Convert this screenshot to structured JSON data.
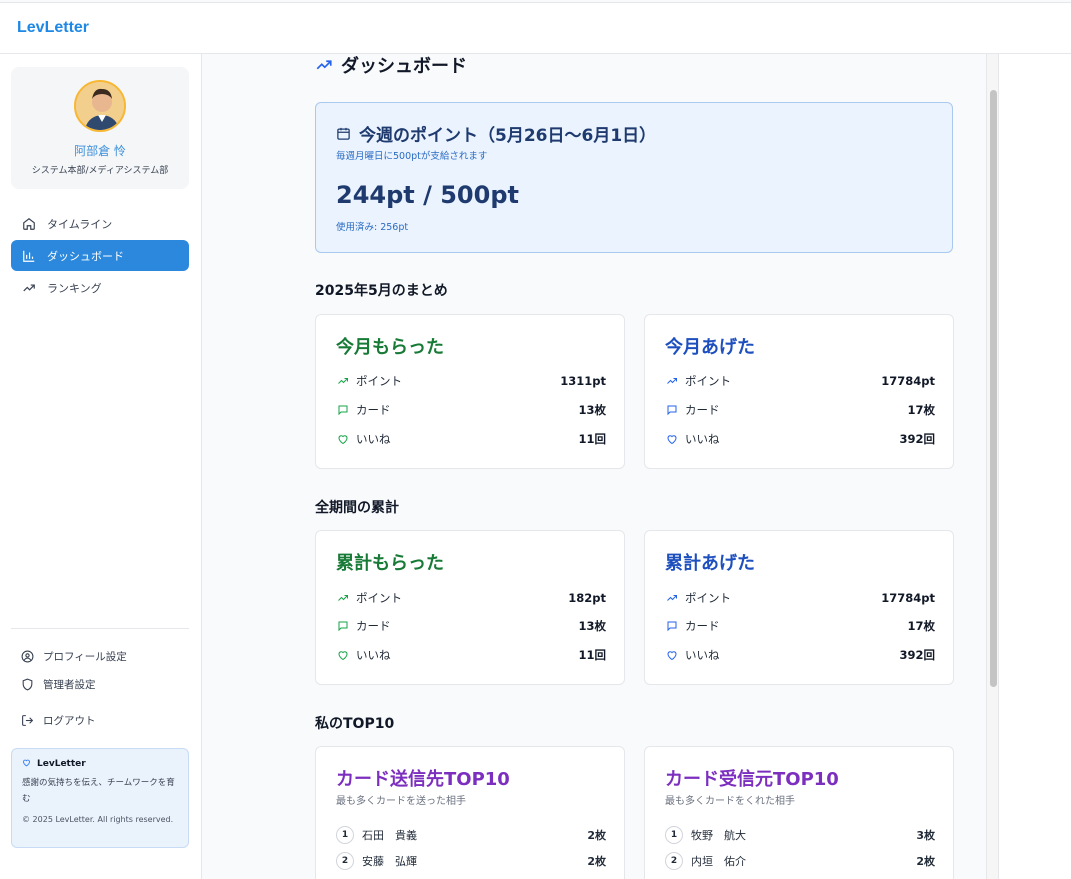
{
  "app": {
    "brand": "LevLetter"
  },
  "user": {
    "name": "阿部倉 怜",
    "department": "システム本部/メディアシステム部"
  },
  "nav": [
    {
      "label": "タイムライン",
      "icon": "home-icon"
    },
    {
      "label": "ダッシュボード",
      "icon": "bar-chart-icon",
      "active": true
    },
    {
      "label": "ランキング",
      "icon": "trending-up-icon"
    }
  ],
  "bottom_nav": {
    "profile": "プロフィール設定",
    "admin": "管理者設定",
    "logout": "ログアウト"
  },
  "info": {
    "title": "LevLetter",
    "text": "感謝の気持ちを伝え、チームワークを育む",
    "copyright": "© 2025 LevLetter. All rights reserved."
  },
  "page": {
    "title": "ダッシュボード"
  },
  "week": {
    "title": "今週のポイント（5月26日〜6月1日）",
    "subtitle": "毎週月曜日に500ptが支給されます",
    "points": "244pt / 500pt",
    "used": "使用済み: 256pt"
  },
  "monthly": {
    "section_title": "2025年5月のまとめ",
    "received": {
      "title": "今月もらった",
      "points_label": "ポイント",
      "points": "1311pt",
      "cards_label": "カード",
      "cards": "13枚",
      "likes_label": "いいね",
      "likes": "11回"
    },
    "given": {
      "title": "今月あげた",
      "points_label": "ポイント",
      "points": "17784pt",
      "cards_label": "カード",
      "cards": "17枚",
      "likes_label": "いいね",
      "likes": "392回"
    }
  },
  "total": {
    "section_title": "全期間の累計",
    "received": {
      "title": "累計もらった",
      "points_label": "ポイント",
      "points": "182pt",
      "cards_label": "カード",
      "cards": "13枚",
      "likes_label": "いいね",
      "likes": "11回"
    },
    "given": {
      "title": "累計あげた",
      "points_label": "ポイント",
      "points": "17784pt",
      "cards_label": "カード",
      "cards": "17枚",
      "likes_label": "いいね",
      "likes": "392回"
    }
  },
  "top10": {
    "section_title": "私のTOP10",
    "sent": {
      "title": "カード送信先TOP10",
      "subtitle": "最も多くカードを送った相手",
      "rows": [
        {
          "rank": "1",
          "name": "石田　貴義",
          "count": "2枚"
        },
        {
          "rank": "2",
          "name": "安藤　弘輝",
          "count": "2枚"
        }
      ]
    },
    "received": {
      "title": "カード受信元TOP10",
      "subtitle": "最も多くカードをくれた相手",
      "rows": [
        {
          "rank": "1",
          "name": "牧野　航大",
          "count": "3枚"
        },
        {
          "rank": "2",
          "name": "内垣　佑介",
          "count": "2枚"
        }
      ]
    }
  },
  "colors": {
    "brand": "#1e88e5",
    "active_nav": "#2b88dc",
    "received": "#177a36",
    "given": "#1d4fbf",
    "top10": "#7c2fbf"
  }
}
